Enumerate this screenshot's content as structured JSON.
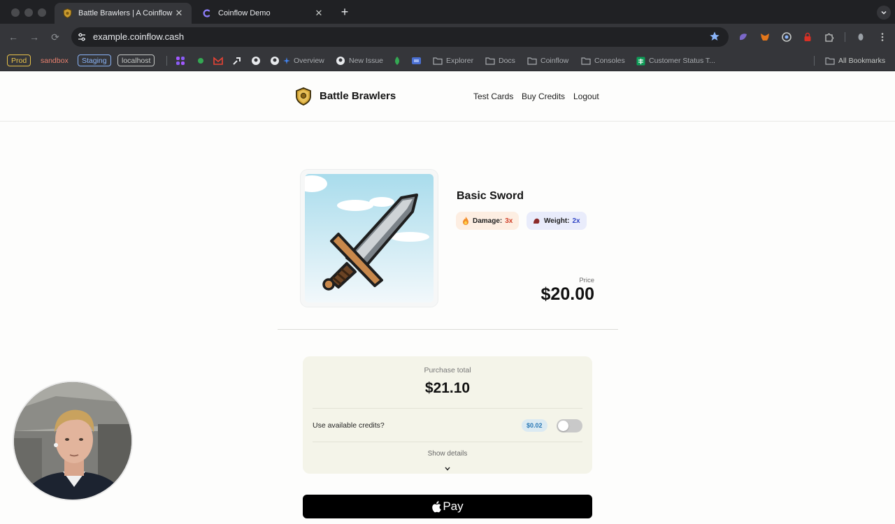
{
  "browser": {
    "tabs": [
      {
        "title": "Battle Brawlers | A Coinflow Demo",
        "favicon": "shield-favicon",
        "active": true
      },
      {
        "title": "Coinflow Demo",
        "favicon": "coinflow-favicon",
        "active": false
      }
    ],
    "url": "example.coinflow.cash",
    "env_tags": [
      {
        "label": "Prod",
        "color": "#e8c24a"
      },
      {
        "label": "sandbox",
        "color": "#e8806e"
      },
      {
        "label": "Staging",
        "color": "#8ab4f8"
      },
      {
        "label": "localhost",
        "color": "#c4c7c5"
      }
    ],
    "bookmarks": {
      "overview": "Overview",
      "new_issue": "New Issue",
      "explorer": "Explorer",
      "docs": "Docs",
      "coinflow": "Coinflow",
      "consoles": "Consoles",
      "customer_status": "Customer Status T...",
      "all_bookmarks": "All Bookmarks"
    }
  },
  "site": {
    "brand": "Battle Brawlers",
    "nav": {
      "test_cards": "Test Cards",
      "buy_credits": "Buy Credits",
      "logout": "Logout"
    }
  },
  "product": {
    "name": "Basic Sword",
    "stats": [
      {
        "label": "Damage:",
        "value": "3x",
        "icon": "fire-icon",
        "bg": "#fdeee2",
        "value_color": "#d0412a"
      },
      {
        "label": "Weight:",
        "value": "2x",
        "icon": "weight-icon",
        "bg": "#e9ecfb",
        "value_color": "#3347c5"
      }
    ],
    "price_label": "Price",
    "price": "$20.00"
  },
  "checkout": {
    "total_label": "Purchase total",
    "total": "$21.10",
    "credits_question": "Use available credits?",
    "credits_amount": "$0.02",
    "credits_enabled": false,
    "show_details": "Show details",
    "pay_button": "Pay"
  },
  "colors": {
    "accent_star": "#8ab4f8",
    "summary_bg": "#f4f4e9"
  }
}
